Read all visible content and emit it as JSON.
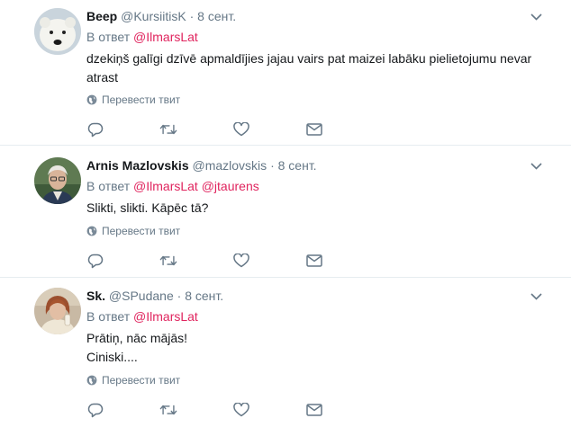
{
  "ui": {
    "reply_prefix": "В ответ",
    "translate_label": "Перевести твит",
    "colors": {
      "mention": "#e0245e",
      "secondary": "#657786",
      "divider": "#e6ecf0"
    },
    "icons": [
      "chevron-down-icon",
      "globe-icon",
      "reply-icon",
      "retweet-icon",
      "like-icon",
      "message-icon"
    ]
  },
  "tweets": [
    {
      "name": "Beep",
      "handle": "@KursiitisK",
      "separator": "·",
      "date": "8 сент.",
      "reply_to": [
        "@IlmarsLat"
      ],
      "text_lines": [
        "dzekiņš galīgi dzīvē apmaldījies jajau vairs pat maizei labāku pielietojumu nevar",
        "atrast"
      ]
    },
    {
      "name": "Arnis Mazlovskis",
      "handle": "@mazlovskis",
      "separator": "·",
      "date": "8 сент.",
      "reply_to": [
        "@IlmarsLat",
        "@jtaurens"
      ],
      "text_lines": [
        "Slikti, slikti. Kāpēc tā?"
      ]
    },
    {
      "name": "Sk.",
      "handle": "@SPudane",
      "separator": "·",
      "date": "8 сент.",
      "reply_to": [
        "@IlmarsLat"
      ],
      "text_lines": [
        "Prātiņ, nāc mājās!",
        "Ciniski...."
      ]
    }
  ]
}
